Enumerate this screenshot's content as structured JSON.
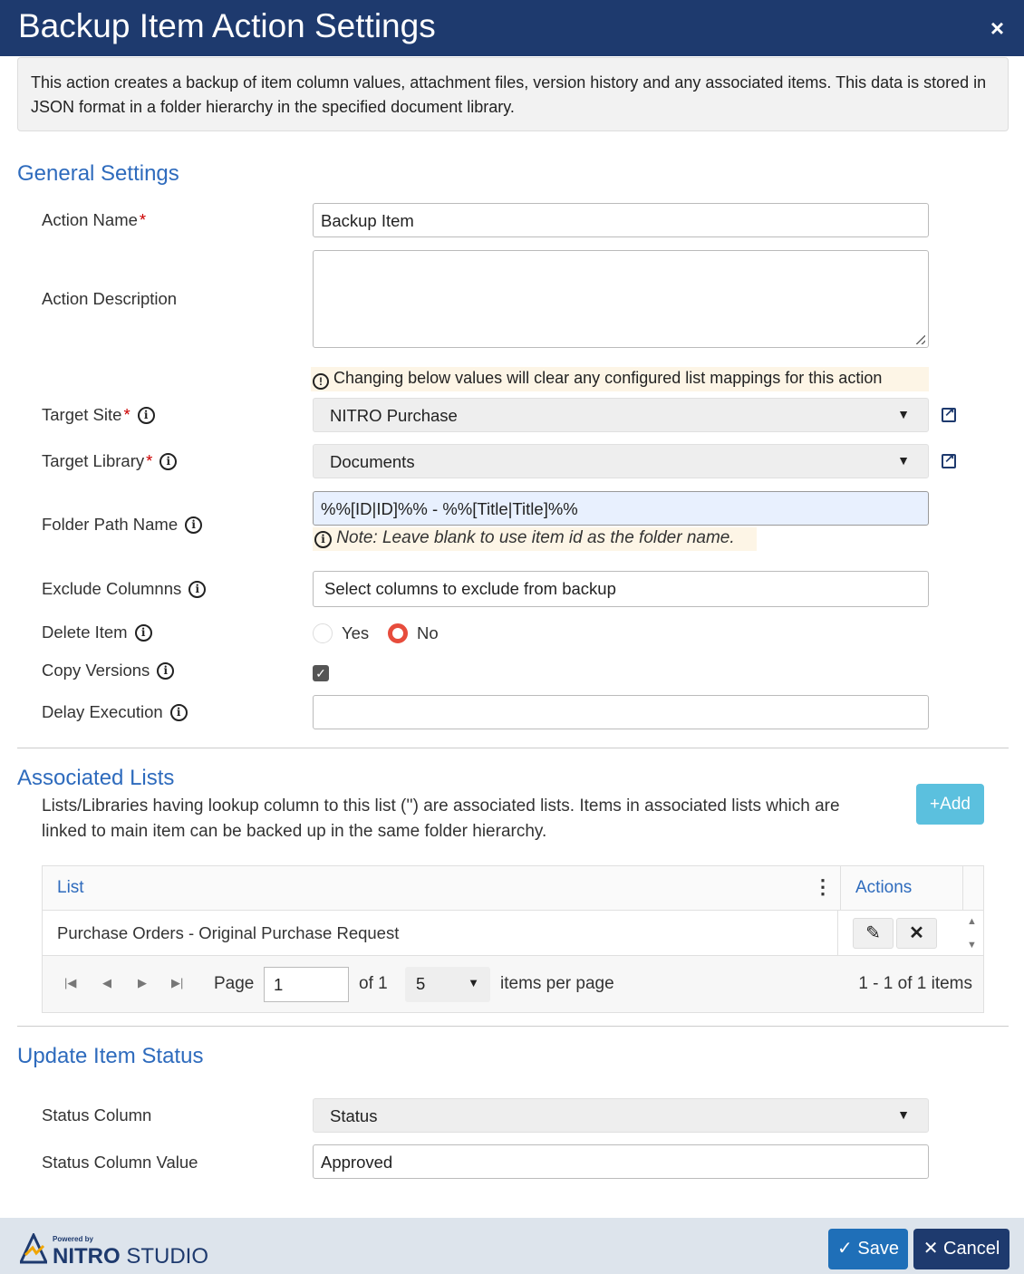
{
  "dialog": {
    "title": "Backup Item Action Settings",
    "close_label": "×"
  },
  "info_text": "This action creates a backup of item column values, attachment files, version history and any associated items. This data is stored in JSON format in a folder hierarchy in the specified document library.",
  "general": {
    "heading": "General Settings",
    "action_name": {
      "label": "Action Name",
      "value": "Backup Item"
    },
    "action_description": {
      "label": "Action Description",
      "value": ""
    },
    "warning": "Changing below values will clear any configured list mappings for this action",
    "target_site": {
      "label": "Target Site",
      "value": "NITRO Purchase"
    },
    "target_library": {
      "label": "Target Library",
      "value": "Documents"
    },
    "folder_path": {
      "label": "Folder Path Name",
      "value": "%%[ID|ID]%% - %%[Title|Title]%%",
      "note": "Note: Leave blank to use item id as the folder name."
    },
    "exclude_columns": {
      "label": "Exclude Columnns",
      "placeholder": "Select columns to exclude from backup"
    },
    "delete_item": {
      "label": "Delete Item",
      "yes": "Yes",
      "no": "No",
      "selected": "No"
    },
    "copy_versions": {
      "label": "Copy Versions",
      "checked": true
    },
    "delay_execution": {
      "label": "Delay Execution",
      "value": ""
    }
  },
  "associated": {
    "heading": "Associated Lists",
    "description": "Lists/Libraries having lookup column to this list ('') are associated lists. Items in associated lists which are linked to main item can be backed up in the same folder hierarchy.",
    "add_label": "Add",
    "columns": {
      "list": "List",
      "actions": "Actions"
    },
    "rows": [
      {
        "list": "Purchase Orders - Original Purchase Request"
      }
    ],
    "pager": {
      "page_label": "Page",
      "page": "1",
      "of_label": "of 1",
      "page_size": "5",
      "ipp_label": "items per page",
      "count": "1 - 1 of 1 items"
    }
  },
  "update_status": {
    "heading": "Update Item Status",
    "status_column": {
      "label": "Status Column",
      "value": "Status"
    },
    "status_value": {
      "label": "Status Column Value",
      "value": "Approved"
    }
  },
  "footer": {
    "powered": "Powered by",
    "brand_bold": "NITRO",
    "brand_light": "STUDIO",
    "save_label": "Save",
    "cancel_label": "Cancel"
  }
}
